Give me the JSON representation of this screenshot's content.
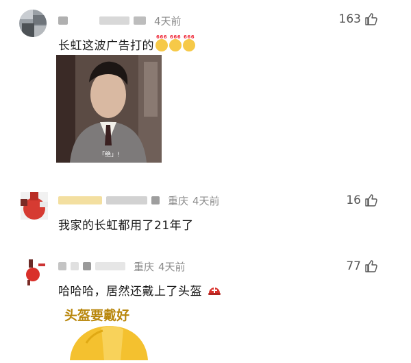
{
  "comments": [
    {
      "time": "4天前",
      "likes": "163",
      "text": "长虹这波广告打的",
      "emojis": [
        "666-emoji",
        "666-emoji",
        "666-emoji"
      ],
      "photo_caption": "「绝」!"
    },
    {
      "location": "重庆",
      "time": "4天前",
      "likes": "16",
      "text": "我家的长虹都用了21年了"
    },
    {
      "location": "重庆",
      "time": "4天前",
      "likes": "77",
      "text": "哈哈哈，居然还戴上了头盔",
      "sticker_text": "头盔要戴好"
    }
  ],
  "colors": {
    "meta_gray": "#8c8c8c",
    "helmet_yellow": "#f4c12f",
    "helmet_red": "#e0342c"
  }
}
